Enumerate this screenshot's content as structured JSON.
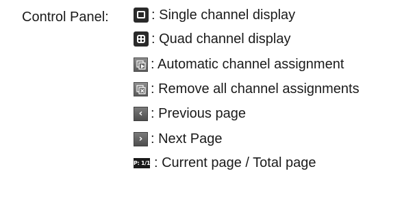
{
  "panel_label": "Control Panel:",
  "items": [
    {
      "icon": "single-channel-icon",
      "text": ": Single channel display"
    },
    {
      "icon": "quad-channel-icon",
      "text": ": Quad channel display"
    },
    {
      "icon": "auto-assign-icon",
      "text": ": Automatic channel assignment"
    },
    {
      "icon": "remove-assign-icon",
      "text": ": Remove all channel assignments"
    },
    {
      "icon": "previous-page-icon",
      "text": ": Previous page",
      "glyph": "‹"
    },
    {
      "icon": "next-page-icon",
      "text": ": Next Page",
      "glyph": "›"
    },
    {
      "icon": "page-indicator-icon",
      "text": ": Current page / Total page",
      "glyph": "P: 1/1"
    }
  ]
}
